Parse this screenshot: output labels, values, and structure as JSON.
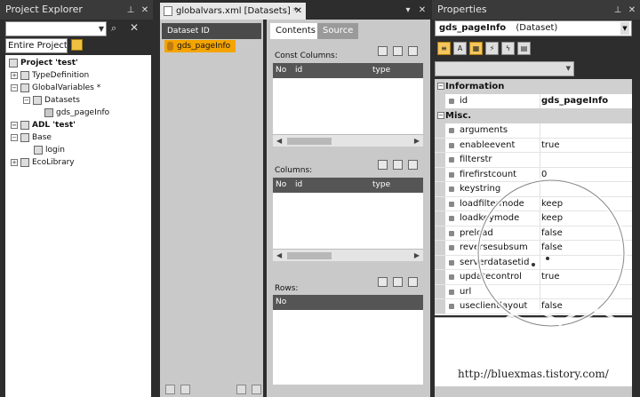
{
  "project_explorer": {
    "title": "Project Explorer",
    "search_value": "",
    "scope": "Entire Project",
    "tree": [
      {
        "label": "Project 'test'",
        "bold": true
      },
      {
        "label": "TypeDefinition"
      },
      {
        "label": "GlobalVariables *"
      },
      {
        "label": "Datasets"
      },
      {
        "label": "gds_pageInfo"
      },
      {
        "label": "ADL 'test'",
        "bold": true
      },
      {
        "label": "Base"
      },
      {
        "label": "login"
      },
      {
        "label": "EcoLibrary"
      }
    ]
  },
  "editor": {
    "tab_label": "globalvars.xml [Datasets] *",
    "dataset_header": "Dataset ID",
    "dataset_item": "gds_pageInfo",
    "tabs": [
      "Contents",
      "Source"
    ],
    "const_columns_label": "Const Columns:",
    "columns_label": "Columns:",
    "rows_label": "Rows:",
    "grid_headers": {
      "no": "No",
      "id": "id",
      "type": "type"
    }
  },
  "properties": {
    "title": "Properties",
    "selected_object": "gds_pageInfo",
    "selected_type": "(Dataset)",
    "categories": {
      "information": "Information",
      "misc": "Misc."
    },
    "info_rows": [
      {
        "name": "id",
        "value": "gds_pageInfo",
        "bold_value": true
      }
    ],
    "misc_rows": [
      {
        "name": "arguments",
        "value": ""
      },
      {
        "name": "enableevent",
        "value": "true"
      },
      {
        "name": "filterstr",
        "value": ""
      },
      {
        "name": "firefirstcount",
        "value": "0"
      },
      {
        "name": "keystring",
        "value": ""
      },
      {
        "name": "loadfiltermode",
        "value": "keep"
      },
      {
        "name": "loadkeymode",
        "value": "keep"
      },
      {
        "name": "preload",
        "value": "false"
      },
      {
        "name": "reversesubsum",
        "value": "false"
      },
      {
        "name": "serverdatasetid",
        "value": ""
      },
      {
        "name": "updatecontrol",
        "value": "true"
      },
      {
        "name": "url",
        "value": ""
      },
      {
        "name": "useclientlayout",
        "value": "false"
      }
    ]
  },
  "watermark_text": "http://bluexmas.tistory.com/"
}
